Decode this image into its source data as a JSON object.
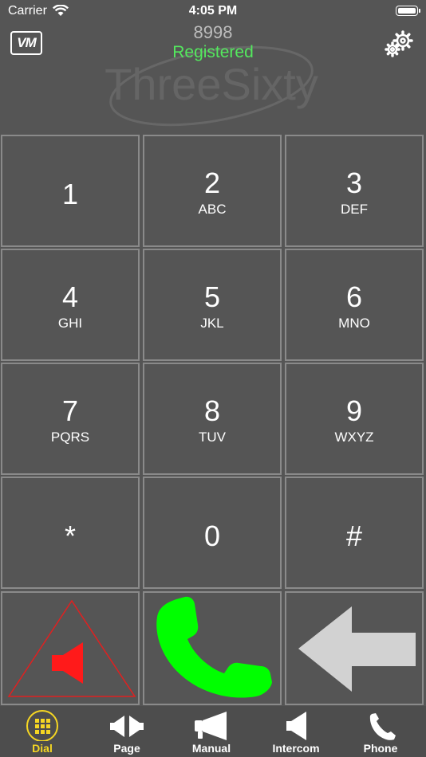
{
  "status_bar": {
    "carrier": "Carrier",
    "time": "4:05 PM"
  },
  "header": {
    "vm_label": "VM",
    "extension": "8998",
    "registration_status": "Registered",
    "logo_text": "ThreeSixty"
  },
  "keypad": {
    "keys": [
      {
        "digit": "1",
        "letters": ""
      },
      {
        "digit": "2",
        "letters": "ABC"
      },
      {
        "digit": "3",
        "letters": "DEF"
      },
      {
        "digit": "4",
        "letters": "GHI"
      },
      {
        "digit": "5",
        "letters": "JKL"
      },
      {
        "digit": "6",
        "letters": "MNO"
      },
      {
        "digit": "7",
        "letters": "PQRS"
      },
      {
        "digit": "8",
        "letters": "TUV"
      },
      {
        "digit": "9",
        "letters": "WXYZ"
      },
      {
        "digit": "*",
        "letters": ""
      },
      {
        "digit": "0",
        "letters": ""
      },
      {
        "digit": "#",
        "letters": ""
      }
    ]
  },
  "actions": {
    "speaker_icon": "speaker-warning-icon",
    "call_icon": "phone-handset-icon",
    "backspace_icon": "back-arrow-icon"
  },
  "tabs": [
    {
      "label": "Dial",
      "icon": "keypad-grid-icon",
      "active": true
    },
    {
      "label": "Page",
      "icon": "page-speakers-icon",
      "active": false
    },
    {
      "label": "Manual",
      "icon": "megaphone-icon",
      "active": false
    },
    {
      "label": "Intercom",
      "icon": "intercom-speaker-icon",
      "active": false
    },
    {
      "label": "Phone",
      "icon": "phone-icon",
      "active": false
    }
  ],
  "colors": {
    "active_tab": "#f5d623",
    "registered": "#54e85e",
    "call": "#00ff00",
    "speaker": "#ff0000",
    "background": "#555555"
  }
}
